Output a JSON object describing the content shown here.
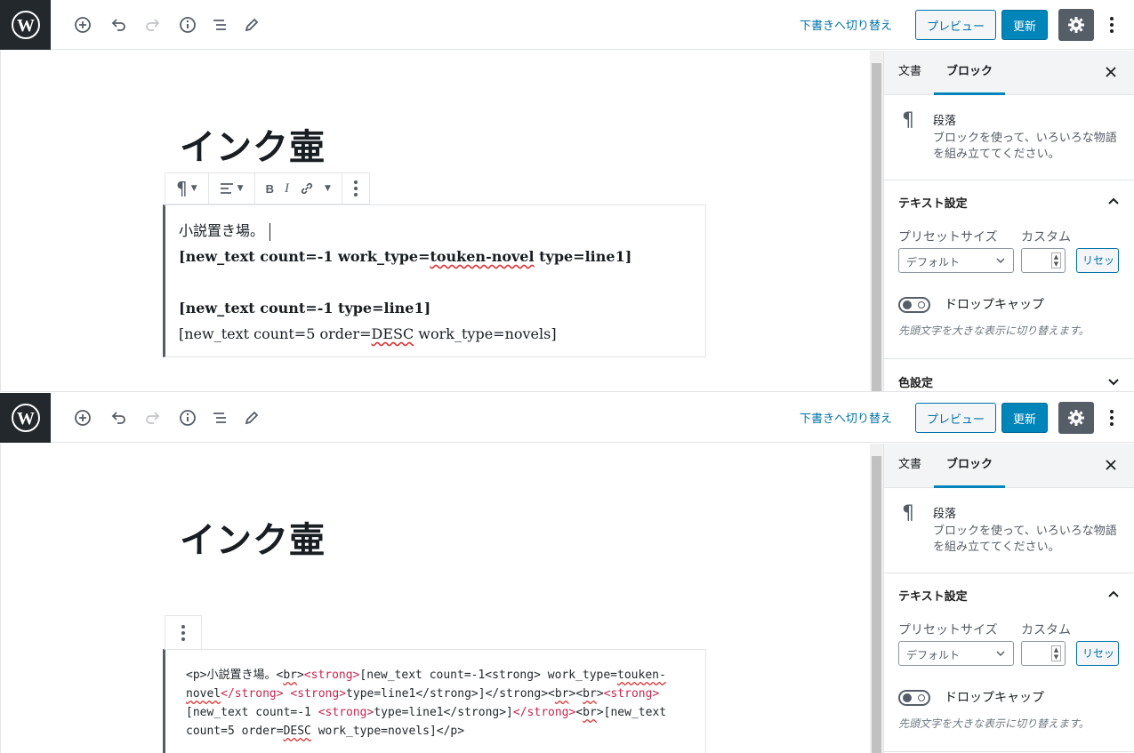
{
  "top_toolbar": {
    "switch_to_draft": "下書きへ切り替え",
    "preview": "プレビュー",
    "update": "更新"
  },
  "post": {
    "title": "インク壷"
  },
  "visual_block": {
    "lines": [
      "小説置き場。",
      "[new_text count=-1 work_type=",
      "touken-novel",
      " type=line1]",
      "[new_text count=-1 type=line1]",
      "[new_text count=5 order=",
      "DESC",
      " work_type=novels]"
    ]
  },
  "html_block": {
    "line1": {
      "a": "<p>小説置き場。<",
      "b": "br",
      "c": ">",
      "d": "<strong>",
      "e": "[new_text count=-1<strong> work_type=",
      "f": "touken-"
    },
    "line2": {
      "a": "novel",
      "b": "</strong>",
      "c": " ",
      "d": "<strong>",
      "e": "type=line1</strong>]</strong><",
      "f": "br",
      "g": "><",
      "h": "br",
      "i": ">",
      "j": "<strong>"
    },
    "line3": {
      "a": "[new_text count=-1 ",
      "b": "<strong>",
      "c": "type=line1</strong>]",
      "d": "</strong>",
      "e": "<",
      "f": "br",
      "g": ">[new_text"
    },
    "line4": {
      "a": "count=5 order=",
      "b": "DESC",
      "c": " work_type=novels]</p>"
    }
  },
  "sidebar": {
    "tabs": [
      "文書",
      "ブロック"
    ],
    "active_tab": "ブロック",
    "block_name": "段落",
    "block_description": "ブロックを使って、いろいろな物語を組み立ててください。",
    "text_settings_title": "テキスト設定",
    "preset_size_label": "プリセットサイズ",
    "custom_label": "カスタム",
    "preset_value": "デフォルト",
    "reset_label": "リセット",
    "drop_cap_label": "ドロップキャップ",
    "drop_cap_help": "先頭文字を大きな表示に切り替えます。",
    "color_settings_title": "色設定"
  },
  "colors": {
    "accent": "#0085ba",
    "link": "#0073aa",
    "wp_logo_bg": "#23282d",
    "settings_btn": "#555d66",
    "html_tag": "#c7254e",
    "spell_error": "#dc3232"
  },
  "icons": [
    "wordpress-logo-icon",
    "add-block-icon",
    "undo-icon",
    "redo-icon",
    "info-icon",
    "outline-icon",
    "edit-icon",
    "gear-icon",
    "more-vertical-icon",
    "close-icon",
    "pilcrow-icon",
    "chevron-up-icon",
    "chevron-down-icon",
    "align-left-icon",
    "bold-icon",
    "italic-icon",
    "link-icon"
  ]
}
